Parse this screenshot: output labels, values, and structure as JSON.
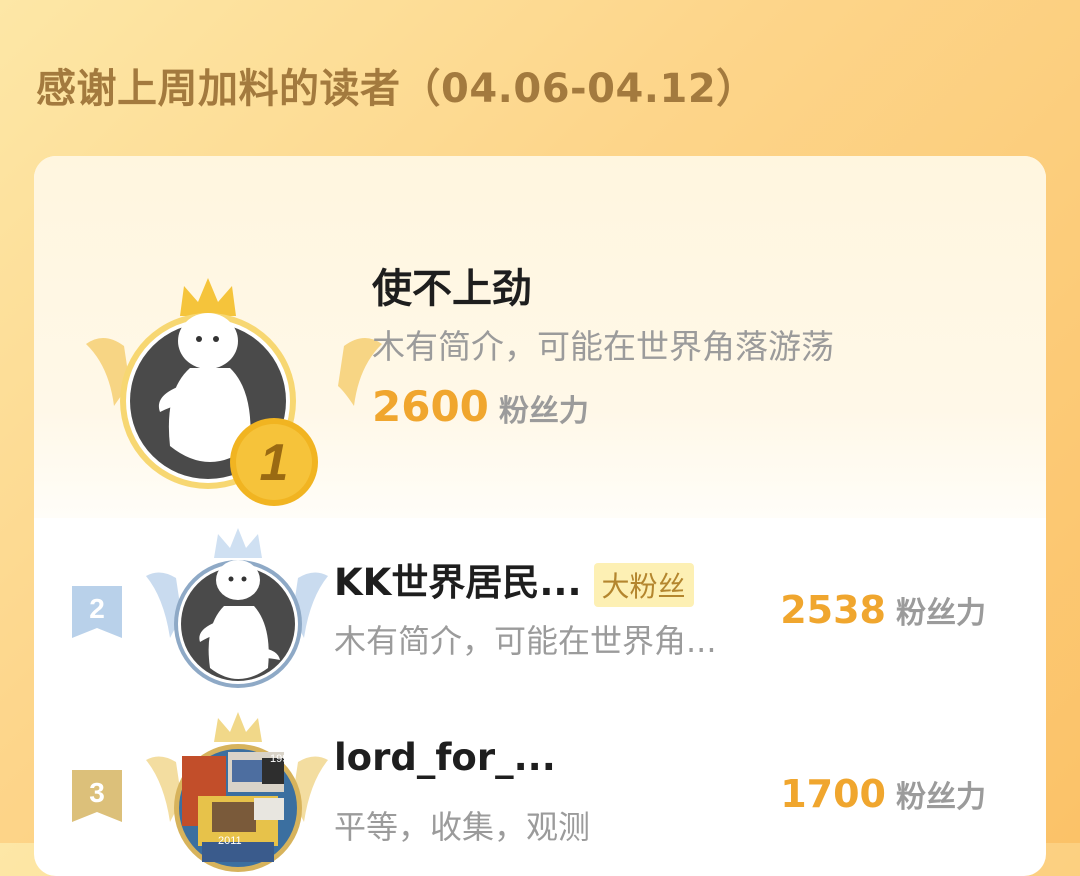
{
  "header": {
    "title": "感谢上周加料的读者（04.06-04.12）"
  },
  "colors": {
    "accent": "#f0a62e",
    "gold": "#f3b92c",
    "silver": "#a9c2df",
    "bronze": "#d9b76a"
  },
  "leaderboard": [
    {
      "rank": "1",
      "name": "使不上劲",
      "bio": "木有简介，可能在世界角落游荡",
      "score": "2600",
      "score_unit": "粉丝力",
      "badge": ""
    },
    {
      "rank": "2",
      "name": "KK世界居民...",
      "bio": "木有简介，可能在世界角...",
      "score": "2538",
      "score_unit": "粉丝力",
      "badge": "大粉丝"
    },
    {
      "rank": "3",
      "name": "lord_for_...",
      "bio": "平等，收集，观测",
      "score": "1700",
      "score_unit": "粉丝力",
      "badge": "",
      "avatar_labels": [
        "1999",
        "2011"
      ]
    }
  ]
}
